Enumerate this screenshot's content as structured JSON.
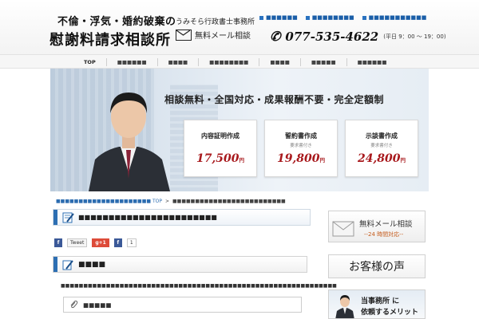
{
  "header": {
    "logo_line1": "不倫・浮気・婚約破棄の",
    "logo_line2": "慰謝料請求相談所",
    "office_name": "うみそら行政書士事務所",
    "mail_label": "無料メール相談",
    "phone_number": "077-535-4622",
    "phone_hours": "(平日 9：00 〜 19：00)",
    "top_links": [
      "■■■■■■",
      "■■■■■■■■",
      "■■■■■■■■■■■"
    ]
  },
  "nav": {
    "items": [
      "TOP",
      "■■■■■■",
      "■■■■",
      "■■■■■■■■",
      "■■■■",
      "■■■■■",
      "■■■■■■"
    ]
  },
  "hero": {
    "tagline": "相談無料・全国対応・成果報酬不要・完全定額制",
    "cards": [
      {
        "title": "内容証明作成",
        "sub": "",
        "price": "17,500",
        "yen": "円"
      },
      {
        "title": "誓約書作成",
        "sub": "要求書付き",
        "price": "19,800",
        "yen": "円"
      },
      {
        "title": "示談書作成",
        "sub": "要求書付き",
        "price": "24,800",
        "yen": "円"
      }
    ]
  },
  "breadcrumb": {
    "link": "■■■■■■■■■■■■■■■■■■■■■ TOP",
    "separator": ">",
    "current": "■■■■■■■■■■■■■■■■■■■■■■■■■"
  },
  "main": {
    "page_title": "■■■■■■■■■■■■■■■■■■■■■■■",
    "social": {
      "fb": "f",
      "tweet": "Tweet",
      "gplus": "g+1",
      "fb_like": "f",
      "count": "1"
    },
    "section_title": "■■■■",
    "body_text": "■■■■■■■■■■■■■■■■■■■■■■■■■■■■■■■■■■■■■■■■■■■■■■■■■■■■■■■■■■■■■",
    "attach_label": "■■■■■"
  },
  "sidebar": {
    "mail_title": "無料メール相談",
    "mail_sub": "--24 時間対応--",
    "voice_title": "お客様の声",
    "merit_line1": "当事務所 に",
    "merit_line2": "依頼するメリット"
  },
  "colors": {
    "accent_blue": "#2d6fb3",
    "price_red": "#a8191d",
    "link_blue": "#2b6cb0"
  }
}
